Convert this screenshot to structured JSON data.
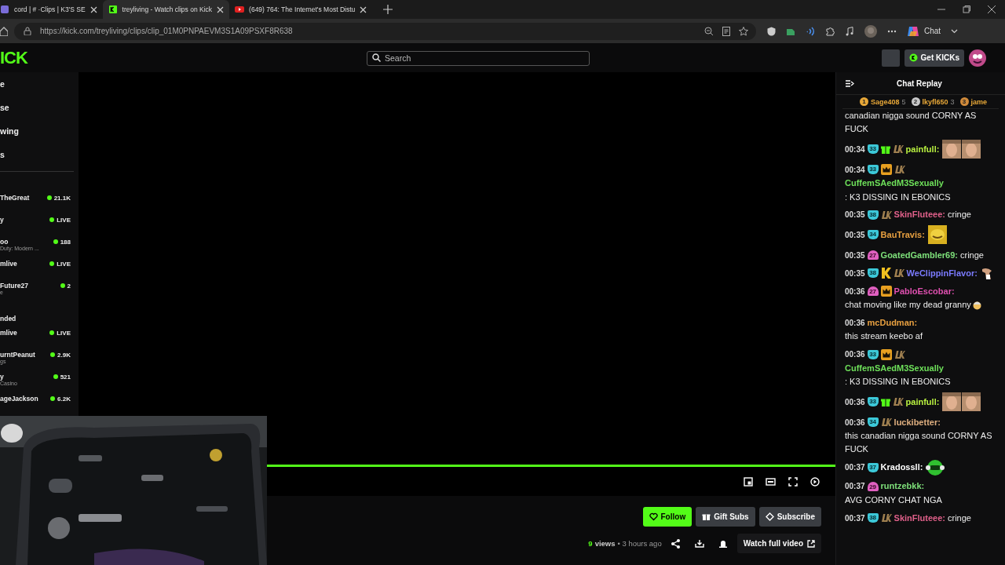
{
  "browser": {
    "tabs": [
      {
        "title": "cord | # ·Clips | K3'S SE",
        "kind": "discord",
        "selected": false
      },
      {
        "title": "treyliving - Watch clips on Kick",
        "kind": "kick",
        "selected": true
      },
      {
        "title": "(649) 764: The Internet's Most Distu",
        "kind": "youtube",
        "selected": false
      }
    ],
    "url": "https://kick.com/treyliving/clips/clip_01M0PNPAEVM3S1A09PSXF8R638",
    "chat_button": "Chat"
  },
  "header": {
    "logo": "ICK",
    "search_placeholder": "Search",
    "get_kicks": "Get KICKs"
  },
  "sidebar": {
    "nav": [
      "e",
      "se",
      "wing",
      "s"
    ],
    "following": [
      {
        "name": "TheGreat",
        "status": "21.1K"
      },
      {
        "name": "y",
        "status": "LIVE"
      },
      {
        "name": "oo",
        "status": "188",
        "subtitle": "Duty: Modern ..."
      },
      {
        "name": "mlive",
        "status": "LIVE"
      },
      {
        "name": "Future27",
        "status": "2",
        "subtitle": "e"
      }
    ],
    "recommended_title": "nded",
    "recommended": [
      {
        "name": "mlive",
        "status": "LIVE"
      },
      {
        "name": "urntPeanut",
        "status": "2.9K",
        "subtitle": "gs"
      },
      {
        "name": "y",
        "status": "521",
        "subtitle": "Casino"
      },
      {
        "name": "ageJackson",
        "status": "6.2K"
      }
    ]
  },
  "video": {
    "progress": {
      "level": 1.0
    }
  },
  "actions": [
    {
      "label": "Follow",
      "kind": "follow"
    },
    {
      "label": "Gift Subs",
      "kind": "gift"
    },
    {
      "label": "Subscribe",
      "kind": "subscribe"
    }
  ],
  "stats": {
    "views": "9",
    "views_label": "views",
    "age": "• 3 hours ago"
  },
  "watch_full": "Watch full video",
  "chat": {
    "title": "Chat Replay",
    "leaders": [
      {
        "rank": "1",
        "name": "Sage408",
        "count": "5",
        "color": "#e8a838"
      },
      {
        "rank": "2",
        "name": "lkyfl650",
        "count": "3",
        "color": "#c8c8c8"
      },
      {
        "rank": "3",
        "name": "jame",
        "color": "#d08a3a"
      }
    ],
    "messages": [
      {
        "kind": "continuation",
        "text": "canadian nigga sound CORNY AS FUCK"
      },
      {
        "kind": "message",
        "time": "00:34",
        "badges": [
          {
            "kind": "sub",
            "label": "33"
          },
          {
            "kind": "gift"
          },
          {
            "kind": "lk"
          }
        ],
        "user": "painfull:",
        "color": "#b8f040",
        "emotes": [
          {
            "kind": "face"
          },
          {
            "kind": "face"
          }
        ]
      },
      {
        "kind": "message",
        "time": "00:34",
        "badges": [
          {
            "kind": "sub",
            "label": "33"
          },
          {
            "kind": "crown"
          },
          {
            "kind": "lk"
          }
        ],
        "user": "CuffemSAedM3Sexually",
        "color": "#6ee05a",
        "text": ": K3 DISSING IN EBONICS"
      },
      {
        "kind": "message",
        "time": "00:35",
        "badges": [
          {
            "kind": "sub",
            "label": "38"
          },
          {
            "kind": "lk"
          }
        ],
        "user": "SkinFluteee:",
        "color": "#e0608a",
        "text": "cringe"
      },
      {
        "kind": "message",
        "time": "00:35",
        "badges": [
          {
            "kind": "sub",
            "label": "34"
          }
        ],
        "user": "BauTravis:",
        "color": "#e8a040",
        "emotes": [
          {
            "kind": "yellow"
          }
        ]
      },
      {
        "kind": "message",
        "time": "00:35",
        "badges": [
          {
            "kind": "pink",
            "label": "27"
          }
        ],
        "user": "GoatedGambler69:",
        "color": "#7ee07a",
        "text": "cringe"
      },
      {
        "kind": "message",
        "time": "00:35",
        "badges": [
          {
            "kind": "sub",
            "label": "38"
          },
          {
            "kind": "k"
          },
          {
            "kind": "lk"
          }
        ],
        "user": "WeClippinFlavor:",
        "color": "#7b7bff",
        "emotes": [
          {
            "kind": "hand"
          }
        ]
      },
      {
        "kind": "message",
        "time": "00:36",
        "badges": [
          {
            "kind": "pink",
            "label": "27"
          },
          {
            "kind": "crown"
          }
        ],
        "user": "PabloEscobar:",
        "color": "#e050b0",
        "text": "chat moving like my dead granny",
        "emotes": [
          {
            "kind": "granny"
          }
        ]
      },
      {
        "kind": "message",
        "time": "00:36",
        "user": "mcDudman:",
        "color": "#e8a040",
        "text": "this stream keebo af"
      },
      {
        "kind": "message",
        "time": "00:36",
        "badges": [
          {
            "kind": "sub",
            "label": "33"
          },
          {
            "kind": "crown"
          },
          {
            "kind": "lk"
          }
        ],
        "user": "CuffemSAedM3Sexually",
        "color": "#6ee05a",
        "text": ": K3 DISSING IN EBONICS"
      },
      {
        "kind": "message",
        "time": "00:36",
        "badges": [
          {
            "kind": "sub",
            "label": "33"
          },
          {
            "kind": "gift"
          },
          {
            "kind": "lk"
          }
        ],
        "user": "painfull:",
        "color": "#b8f040",
        "emotes": [
          {
            "kind": "face"
          },
          {
            "kind": "face"
          }
        ]
      },
      {
        "kind": "message",
        "time": "00:36",
        "badges": [
          {
            "kind": "sub",
            "label": "34"
          },
          {
            "kind": "lk"
          }
        ],
        "user": "luckibetter:",
        "color": "#e0b080",
        "text": "this canadian nigga sound CORNY AS FUCK"
      },
      {
        "kind": "message",
        "time": "00:37",
        "badges": [
          {
            "kind": "sub",
            "label": "37"
          }
        ],
        "user": "Kradossll:",
        "color": "#ffffff",
        "emotes": [
          {
            "kind": "green"
          }
        ]
      },
      {
        "kind": "message",
        "time": "00:37",
        "badges": [
          {
            "kind": "pink",
            "label": "29"
          }
        ],
        "user": "runtzebkk:",
        "color": "#7ee07a",
        "text": "AVG CORNY CHAT NGA"
      },
      {
        "kind": "message",
        "time": "00:37",
        "badges": [
          {
            "kind": "sub",
            "label": "38"
          },
          {
            "kind": "lk"
          }
        ],
        "user": "SkinFluteee:",
        "color": "#e0608a",
        "text": "cringe"
      }
    ]
  }
}
